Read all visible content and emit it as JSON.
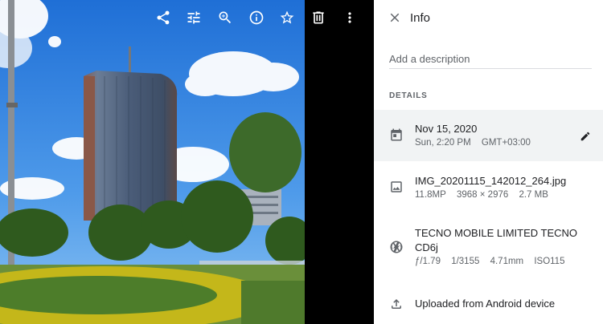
{
  "toolbar": {
    "icons": [
      "share-icon",
      "edit-adjust-icon",
      "zoom-in-icon",
      "info-icon",
      "star-icon",
      "delete-icon",
      "more-vert-icon"
    ]
  },
  "panel": {
    "title": "Info",
    "description_placeholder": "Add a description",
    "details_label": "DETAILS",
    "date": {
      "main": "Nov 15, 2020",
      "time": "Sun, 2:20 PM",
      "timezone": "GMT+03:00"
    },
    "file": {
      "name": "IMG_20201115_142012_264.jpg",
      "megapixels": "11.8MP",
      "resolution": "3968 × 2976",
      "size": "2.7 MB"
    },
    "camera": {
      "model": "TECNO MOBILE LIMITED TECNO CD6j",
      "aperture": "ƒ/1.79",
      "shutter": "1/3155",
      "focal": "4.71mm",
      "iso": "ISO115"
    },
    "upload": {
      "text": "Uploaded from Android device"
    }
  },
  "colors": {
    "panel_bg": "#ffffff",
    "highlight_row": "#f1f3f4",
    "text_primary": "#202124",
    "text_secondary": "#5f6368",
    "viewer_bg": "#000000"
  }
}
